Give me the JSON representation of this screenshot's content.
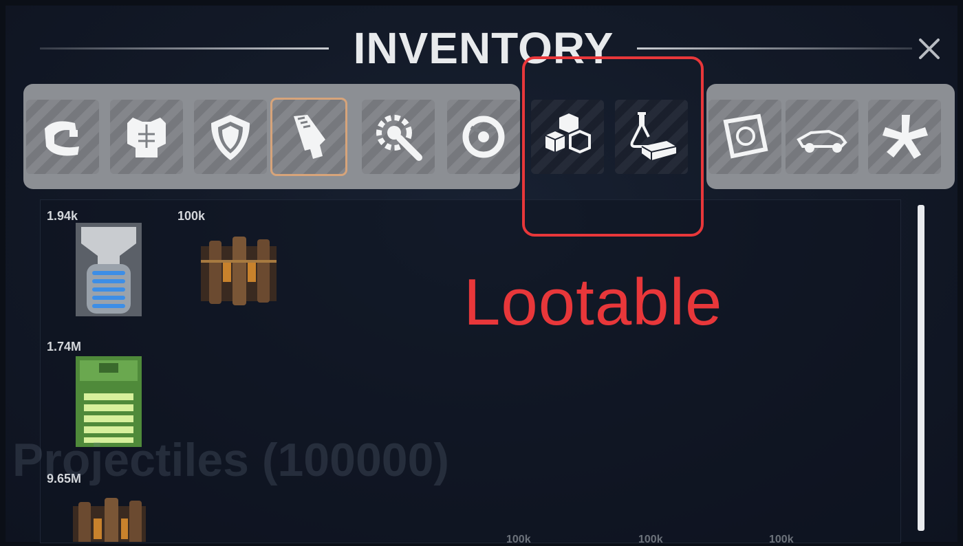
{
  "window": {
    "title": "INVENTORY",
    "close_label": "×"
  },
  "tabs": [
    {
      "icon": "ammo-icon"
    },
    {
      "icon": "armor-icon"
    },
    {
      "icon": "shield-icon"
    },
    {
      "icon": "weapon-icon",
      "active": true
    },
    {
      "icon": "tools-icon"
    },
    {
      "icon": "consumable-icon"
    },
    {
      "icon": "materials-icon"
    },
    {
      "icon": "resources-icon"
    },
    {
      "icon": "blueprint-icon"
    },
    {
      "icon": "vehicle-icon"
    },
    {
      "icon": "misc-icon"
    }
  ],
  "annotation": {
    "label": "Lootable",
    "color": "#e8373a"
  },
  "items": [
    {
      "count": "1.94k",
      "icon": "energy-cell-icon"
    },
    {
      "count": "100k",
      "icon": "ammo-crate-icon"
    },
    {
      "count": "1.74M",
      "icon": "battery-icon"
    },
    {
      "count": "9.65M",
      "icon": "ammo-crate-icon"
    }
  ],
  "faint_text": {
    "category": "Projectiles (100000)",
    "counts": [
      "100k",
      "100k",
      "100k"
    ]
  }
}
